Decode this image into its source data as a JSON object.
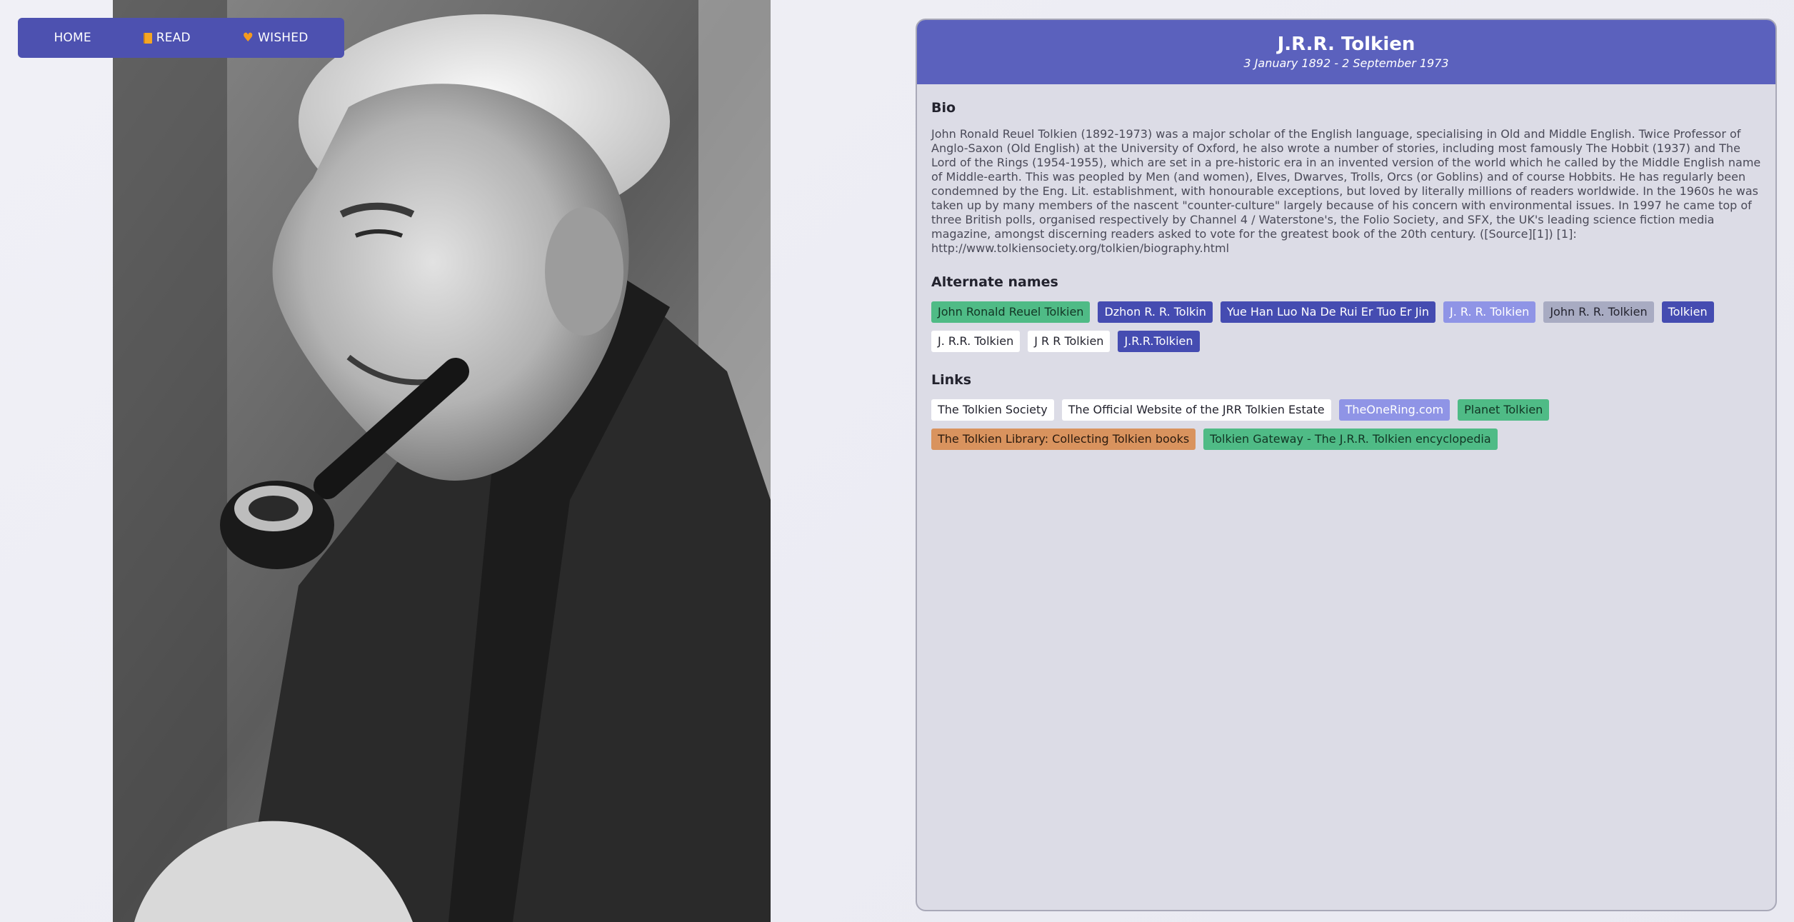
{
  "nav": {
    "home": "HOME",
    "read": "READ",
    "wished": "WISHED"
  },
  "author": {
    "name": "J.R.R. Tolkien",
    "dates": "3 January 1892 - 2 September 1973",
    "photo": "Black and white portrait photo"
  },
  "bio": {
    "title": "Bio",
    "text": "John Ronald Reuel Tolkien (1892-1973) was a major scholar of the English language, specialising in Old and Middle English. Twice Professor of Anglo-Saxon (Old English) at the University of Oxford, he also wrote a number of stories, including most famously The Hobbit (1937) and The Lord of the Rings (1954-1955), which are set in a pre-historic era in an invented version of the world which he called by the Middle English name of Middle-earth. This was peopled by Men (and women), Elves, Dwarves, Trolls, Orcs (or Goblins) and of course Hobbits. He has regularly been condemned by the Eng. Lit. establishment, with honourable exceptions, but loved by literally millions of readers worldwide.  In the 1960s he was taken up by many members of the nascent \"counter-culture\" largely because of his concern with environmental issues. In 1997 he came top of three British polls, organised respectively by Channel 4 / Waterstone's, the Folio Society, and SFX, the UK's leading science fiction media magazine, amongst discerning readers asked to vote for the greatest book of the 20th century.   ([Source][1])   [1]: http://www.tolkiensociety.org/tolkien/biography.html"
  },
  "alternate_names": {
    "title": "Alternate names",
    "items": [
      {
        "label": "John Ronald Reuel Tolkien",
        "bg": "#4fbb86",
        "fg": "#123524"
      },
      {
        "label": "Dzhon R. R. Tolkin",
        "bg": "#454cb1",
        "fg": "#ffffff"
      },
      {
        "label": "Yue Han Luo Na De Rui Er Tuo Er Jin",
        "bg": "#454cb1",
        "fg": "#ffffff"
      },
      {
        "label": "J. R. R. Tolkien",
        "bg": "#8f94e6",
        "fg": "#ffffff"
      },
      {
        "label": "John R. R. Tolkien",
        "bg": "#a8abc2",
        "fg": "#23232e"
      },
      {
        "label": "Tolkien",
        "bg": "#454cb1",
        "fg": "#ffffff"
      },
      {
        "label": "J. R.R. Tolkien",
        "bg": "#ffffff",
        "fg": "#23232e"
      },
      {
        "label": "J R R Tolkien",
        "bg": "#ffffff",
        "fg": "#23232e"
      },
      {
        "label": "J.R.R.Tolkien",
        "bg": "#454cb1",
        "fg": "#ffffff"
      }
    ]
  },
  "links": {
    "title": "Links",
    "items": [
      {
        "label": "The Tolkien Society",
        "bg": "#ffffff",
        "fg": "#23232e"
      },
      {
        "label": "The Official Website of the JRR Tolkien Estate",
        "bg": "#ffffff",
        "fg": "#23232e"
      },
      {
        "label": "TheOneRing.com",
        "bg": "#8f94e6",
        "fg": "#ffffff"
      },
      {
        "label": "Planet Tolkien",
        "bg": "#4fbb86",
        "fg": "#123524"
      },
      {
        "label": "The Tolkien Library: Collecting Tolkien books",
        "bg": "#d9935e",
        "fg": "#2b1a0e"
      },
      {
        "label": "Tolkien Gateway - The J.R.R. Tolkien encyclopedia",
        "bg": "#4fbb86",
        "fg": "#123524"
      }
    ]
  }
}
